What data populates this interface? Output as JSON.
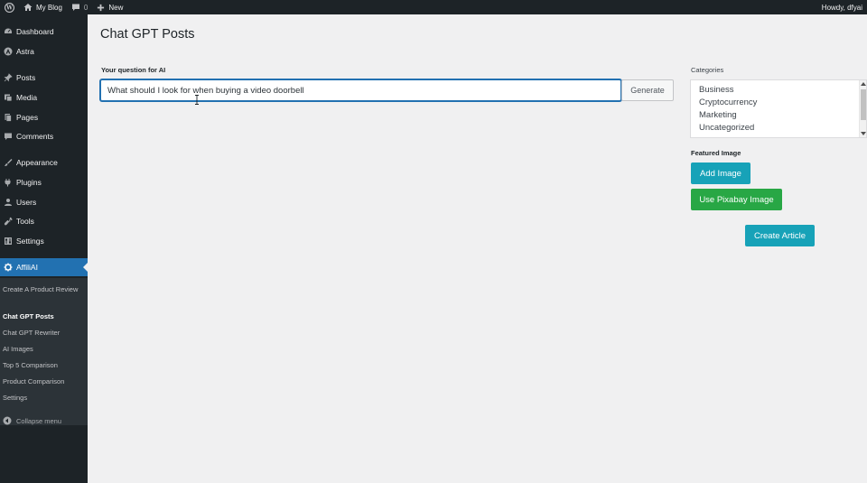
{
  "adminbar": {
    "site_name": "My Blog",
    "comments_count": "0",
    "new_label": "New",
    "greeting": "Howdy, dfyai"
  },
  "sidebar": {
    "items": [
      {
        "label": "Dashboard",
        "icon": "dashboard-icon"
      },
      {
        "label": "Astra",
        "icon": "astra-icon"
      },
      {
        "label": "Posts",
        "icon": "pin-icon"
      },
      {
        "label": "Media",
        "icon": "media-icon"
      },
      {
        "label": "Pages",
        "icon": "pages-icon"
      },
      {
        "label": "Comments",
        "icon": "comment-icon"
      },
      {
        "label": "Appearance",
        "icon": "brush-icon"
      },
      {
        "label": "Plugins",
        "icon": "plugin-icon"
      },
      {
        "label": "Users",
        "icon": "users-icon"
      },
      {
        "label": "Tools",
        "icon": "wrench-icon"
      },
      {
        "label": "Settings",
        "icon": "settings-icon"
      },
      {
        "label": "AffiliAI",
        "icon": "gear-icon"
      }
    ],
    "submenu": [
      "Create A Product Review",
      "Chat GPT Posts",
      "Chat GPT Rewriter",
      "AI Images",
      "Top 5 Comparison",
      "Product Comparison",
      "Settings"
    ],
    "collapse_label": "Collapse menu"
  },
  "main": {
    "title": "Chat GPT Posts",
    "question_label": "Your question for AI",
    "question_value": "What should I look for when buying a video doorbell",
    "generate_label": "Generate"
  },
  "right": {
    "categories_label": "Categories",
    "categories": [
      "Business",
      "Cryptocurrency",
      "Marketing",
      "Uncategorized"
    ],
    "featured_image_label": "Featured Image",
    "add_image_label": "Add Image",
    "pixabay_label": "Use Pixabay Image",
    "create_article_label": "Create Article"
  },
  "colors": {
    "sidebar_bg": "#1d2327",
    "active_menu": "#2271b1",
    "info_button": "#17a2b8",
    "success_button": "#28a745"
  }
}
